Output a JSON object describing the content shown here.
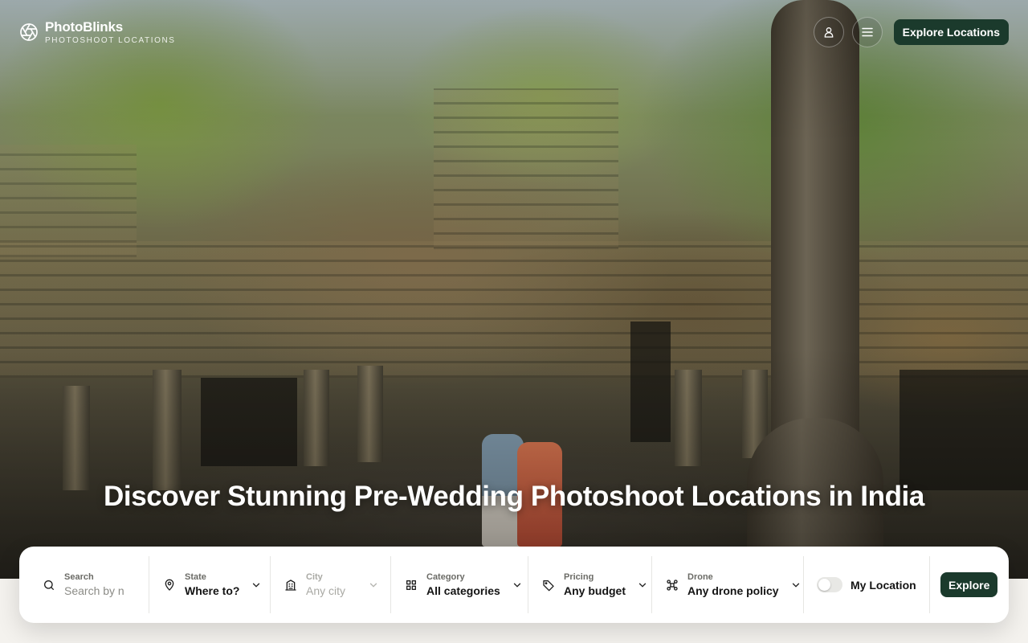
{
  "brand": {
    "name": "PhotoBlinks",
    "tagline": "PHOTOSHOOT LOCATIONS"
  },
  "header": {
    "account_icon": "user-icon",
    "menu_icon": "hamburger-icon",
    "cta_label": "Explore Locations"
  },
  "hero": {
    "headline": "Discover Stunning Pre-Wedding Photoshoot Locations in India"
  },
  "search": {
    "search": {
      "label": "Search",
      "placeholder": "Search by n",
      "icon": "search-icon"
    },
    "state": {
      "label": "State",
      "value": "Where to?",
      "icon": "map-pin-icon"
    },
    "city": {
      "label": "City",
      "value": "Any city",
      "icon": "building-icon"
    },
    "category": {
      "label": "Category",
      "value": "All categories",
      "icon": "grid-icon"
    },
    "pricing": {
      "label": "Pricing",
      "value": "Any budget",
      "icon": "tag-icon"
    },
    "drone": {
      "label": "Drone",
      "value": "Any drone policy",
      "icon": "drone-icon"
    },
    "my_location": {
      "label": "My Location",
      "enabled": false
    },
    "explore_label": "Explore"
  },
  "colors": {
    "brand_dark_green": "#1b3a2c",
    "page_background": "#f4f2ee"
  }
}
